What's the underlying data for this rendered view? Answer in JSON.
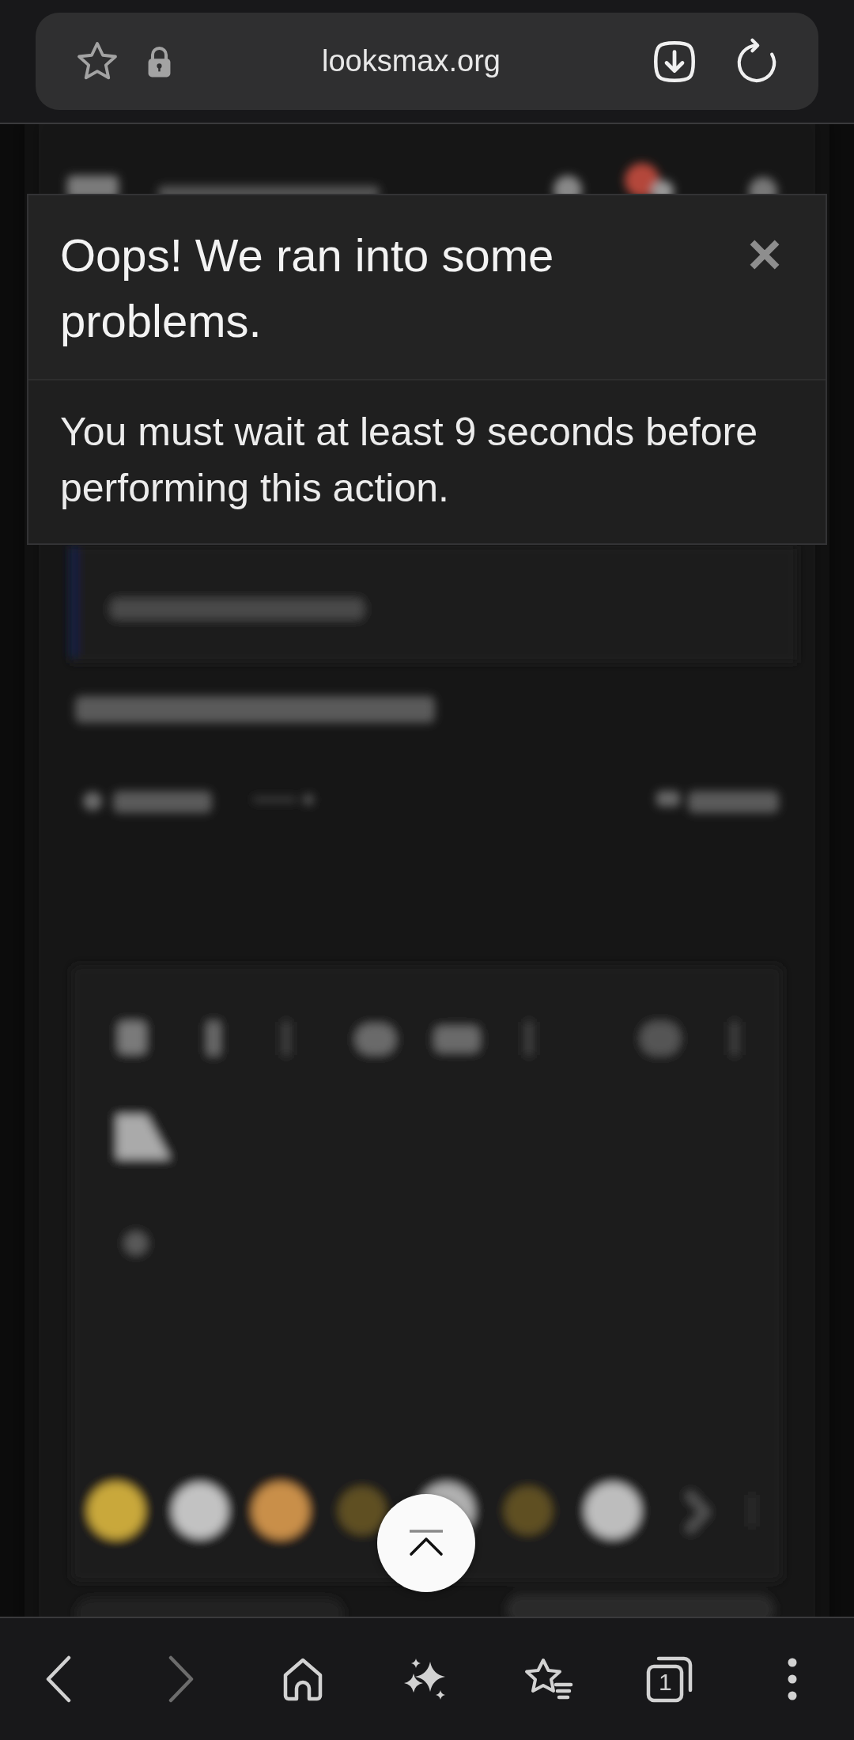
{
  "address_bar": {
    "url": "looksmax.org"
  },
  "dialog": {
    "title": "Oops! We ran into some problems.",
    "message": "You must wait at least 9 seconds before performing this action."
  },
  "bottom_bar": {
    "items": [
      {
        "kind": "back",
        "disabled": false
      },
      {
        "kind": "forward",
        "disabled": true
      },
      {
        "kind": "home",
        "disabled": false
      },
      {
        "kind": "assistant",
        "disabled": false
      },
      {
        "kind": "bookmarks",
        "disabled": false
      },
      {
        "kind": "tabs",
        "disabled": false,
        "count": "1"
      },
      {
        "kind": "menu",
        "disabled": false
      }
    ]
  }
}
